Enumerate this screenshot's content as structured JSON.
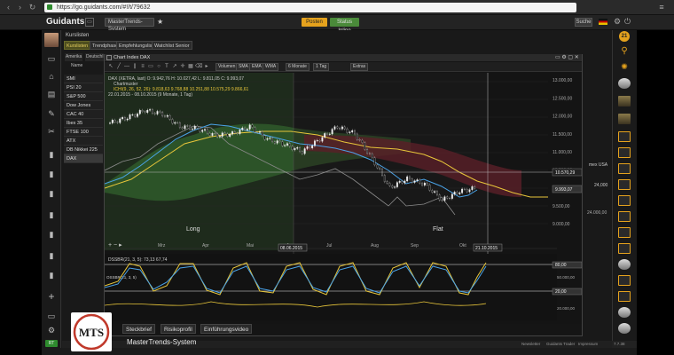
{
  "browser": {
    "url": "https://go.guidants.com/#!/t/79632"
  },
  "header": {
    "logo": "Guidants",
    "portfolio_label": "MasterTrends-System",
    "post_label": "Posten",
    "status_label": "Status Inline",
    "search_label": "Suche"
  },
  "workspace": {
    "title": "Kurslisten",
    "tabs": [
      "Kurslisten",
      "Trendphasen",
      "Empfehlungslisten",
      "Watchlist Senior"
    ]
  },
  "index_list": {
    "tabs": [
      "Amerika",
      "Deutschl"
    ],
    "subhead": "Name",
    "rows": [
      "SMI",
      "PSI 20",
      "S&P 500",
      "Dow Jones Indus",
      "CAC 40",
      "Ibex 35",
      "FTSE 100",
      "ATX",
      "DB Nikkei 225",
      "DAX"
    ],
    "selected": "DAX"
  },
  "widget": {
    "title": "Chart Index DAX",
    "toolbar": {
      "volume": "Volumen",
      "sma": "SMA",
      "ema": "EMA",
      "wma": "WMA",
      "range": "6 Monate",
      "interval": "1 Tag",
      "extras": "Extras"
    }
  },
  "chart_data": {
    "type": "line",
    "instrument": "DAX (XETRA, last)",
    "ohlc": {
      "open": "9.942,76",
      "high": "10.027,42",
      "low": "9.811,05",
      "close": "9.993,07"
    },
    "legend": [
      "Chartmuster",
      "ICHI(9, 26, 52, 26): 9.818,63  9.768,88  10.251,88  10.575,29  9.866,61"
    ],
    "period_label": "22.01.2015 - 08.10.2015 (9 Monate, 1 Tag)",
    "annotations": [
      "Long",
      "Flat"
    ],
    "x_ticks": [
      "Mrz",
      "Apr",
      "Mai",
      "Jun",
      "Jul",
      "Aug",
      "Sep",
      "Okt"
    ],
    "markers": {
      "cursor_date": "08.06.2015",
      "end_date": "21.10.2015",
      "crosshair_value": "10.570,29",
      "last_price": "9.993,07"
    },
    "y_ticks": [
      "13.000,00",
      "12.500,00",
      "12.000,00",
      "11.500,00",
      "11.000,00",
      "10.500,00",
      "10.000,00",
      "9.500,00",
      "9.000,00"
    ],
    "series": [
      {
        "name": "DAX",
        "values": [
          11800,
          11950,
          12150,
          12050,
          11700,
          11650,
          11450,
          11500,
          11700,
          11350,
          11200,
          11000,
          11350,
          11700,
          11500,
          10800,
          10000,
          10250,
          10100,
          9650,
          9900,
          10000
        ]
      }
    ],
    "oscillator": {
      "label": "DSSBR(21, 3, 5): 73,13  67,74",
      "y_ticks": [
        "80,00",
        "20,00"
      ],
      "secondary_label": "OSSBR(21, 3, 5)",
      "volume_ticks": [
        "50.000,00",
        "20.000,00"
      ]
    }
  },
  "right_labels": {
    "index_name": "mex USA",
    "value_top": "24.000,00",
    "value_mid": "24,000"
  },
  "bottom_tabs": [
    "Steckbrief",
    "Risikoprofil",
    "Einführungsvideo"
  ],
  "system_name": "MasterTrends-System",
  "brand_logo": "MTS",
  "footer_links": [
    "Newsletter",
    "Guidants Trader",
    "Impressum"
  ],
  "footer_right": "7.7.38",
  "colors": {
    "accent": "#e5a21d",
    "ichimoku_cloud_green": "#2f5a2a",
    "ichimoku_cloud_red": "#5a1f28",
    "price": "#f0f0f0",
    "tenkan": "#4aa3e8",
    "kijun": "#e8c63a"
  }
}
